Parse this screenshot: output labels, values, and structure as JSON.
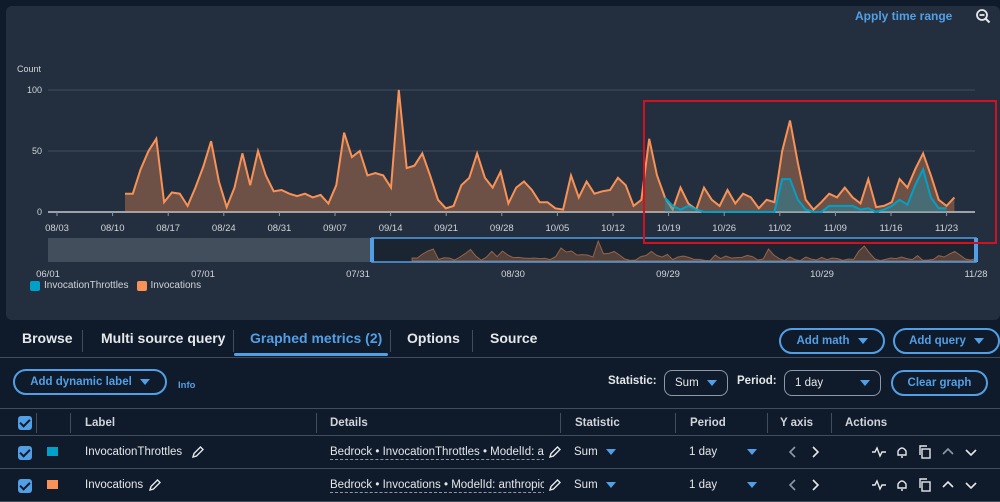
{
  "graph": {
    "apply_time_range": "Apply time range",
    "y_unit": "Count",
    "y_ticks": [
      "100",
      "50",
      "0"
    ],
    "x_ticks": [
      "08/03",
      "08/10",
      "08/17",
      "08/24",
      "08/31",
      "09/07",
      "09/14",
      "09/21",
      "09/28",
      "10/05",
      "10/12",
      "10/19",
      "10/26",
      "11/02",
      "11/09",
      "11/16",
      "11/23"
    ],
    "overview_ticks": [
      "06/01",
      "07/01",
      "07/31",
      "08/30",
      "09/29",
      "10/29",
      "11/28"
    ],
    "legend": [
      {
        "name": "InvocationThrottles",
        "color": "#00a1c9"
      },
      {
        "name": "Invocations",
        "color": "#f89256"
      }
    ],
    "highlight_color": "#d1111f"
  },
  "chart_data": {
    "type": "area",
    "ylabel": "Count",
    "ylim": [
      0,
      100
    ],
    "x": [
      "08/10",
      "08/11",
      "08/12",
      "08/13",
      "08/14",
      "08/15",
      "08/16",
      "08/17",
      "08/18",
      "08/19",
      "08/20",
      "08/21",
      "08/22",
      "08/23",
      "08/24",
      "08/25",
      "08/26",
      "08/27",
      "08/28",
      "08/29",
      "08/30",
      "08/31",
      "09/01",
      "09/02",
      "09/03",
      "09/04",
      "09/05",
      "09/06",
      "09/07",
      "09/08",
      "09/09",
      "09/10",
      "09/11",
      "09/12",
      "09/13",
      "09/14",
      "09/15",
      "09/16",
      "09/17",
      "09/18",
      "09/19",
      "09/20",
      "09/21",
      "09/22",
      "09/23",
      "09/24",
      "09/25",
      "09/26",
      "09/27",
      "09/28",
      "09/29",
      "09/30",
      "10/01",
      "10/02",
      "10/03",
      "10/04",
      "10/05",
      "10/06",
      "10/07",
      "10/08",
      "10/09",
      "10/10",
      "10/11",
      "10/12",
      "10/13",
      "10/14",
      "10/15",
      "10/16",
      "10/17",
      "10/18",
      "10/19",
      "10/20",
      "10/21",
      "10/22",
      "10/23",
      "10/24",
      "10/25",
      "10/26",
      "10/27",
      "10/28",
      "10/29",
      "10/30",
      "10/31",
      "11/01",
      "11/02",
      "11/03",
      "11/04",
      "11/05",
      "11/06",
      "11/07",
      "11/08",
      "11/09",
      "11/10",
      "11/11",
      "11/12",
      "11/13",
      "11/14",
      "11/15",
      "11/16",
      "11/17",
      "11/18",
      "11/19",
      "11/20",
      "11/21",
      "11/22",
      "11/23",
      "11/24",
      "11/25",
      "11/26"
    ],
    "series": [
      {
        "name": "Invocations",
        "color": "#f89256",
        "values": [
          15,
          15,
          35,
          50,
          60,
          8,
          16,
          15,
          5,
          20,
          37,
          58,
          25,
          4,
          20,
          48,
          22,
          50,
          30,
          17,
          18,
          15,
          13,
          15,
          12,
          14,
          7,
          22,
          65,
          45,
          50,
          30,
          32,
          30,
          20,
          100,
          36,
          38,
          48,
          30,
          10,
          3,
          5,
          22,
          28,
          48,
          28,
          20,
          33,
          7,
          20,
          25,
          18,
          8,
          8,
          3,
          2,
          30,
          12,
          25,
          15,
          17,
          18,
          28,
          22,
          5,
          10,
          60,
          30,
          12,
          2,
          20,
          7,
          2,
          20,
          10,
          5,
          18,
          7,
          15,
          12,
          3,
          10,
          8,
          50,
          75,
          40,
          10,
          2,
          8,
          15,
          12,
          20,
          12,
          7,
          27,
          4,
          5,
          8,
          27,
          20,
          35,
          48,
          30,
          10,
          5,
          12
        ]
      },
      {
        "name": "InvocationThrottles",
        "color": "#00a1c9",
        "values": [
          null,
          null,
          null,
          null,
          null,
          null,
          null,
          null,
          null,
          null,
          null,
          null,
          null,
          null,
          null,
          null,
          null,
          null,
          null,
          null,
          null,
          null,
          null,
          null,
          null,
          null,
          null,
          null,
          null,
          null,
          null,
          null,
          null,
          null,
          null,
          null,
          null,
          null,
          null,
          null,
          null,
          null,
          null,
          null,
          null,
          null,
          null,
          null,
          null,
          null,
          null,
          null,
          null,
          null,
          null,
          null,
          null,
          null,
          null,
          null,
          null,
          null,
          null,
          null,
          null,
          null,
          null,
          null,
          null,
          12,
          5,
          2,
          5,
          2,
          0,
          0,
          0,
          0,
          0,
          0,
          0,
          0,
          0,
          0,
          27,
          27,
          10,
          2,
          0,
          0,
          5,
          5,
          5,
          5,
          2,
          3,
          0,
          2,
          5,
          10,
          6,
          22,
          35,
          12,
          3,
          3,
          null
        ]
      }
    ]
  },
  "tabs": [
    {
      "label": "Browse"
    },
    {
      "label": "Multi source query"
    },
    {
      "label": "Graphed metrics (2)",
      "active": true
    },
    {
      "label": "Options"
    },
    {
      "label": "Source"
    }
  ],
  "toolbar": {
    "add_math": "Add math",
    "add_query": "Add query",
    "add_dynamic_label": "Add dynamic label",
    "info": "Info",
    "statistic_label": "Statistic:",
    "statistic_value": "Sum",
    "period_label": "Period:",
    "period_value": "1 day",
    "clear_graph": "Clear graph"
  },
  "table": {
    "headers": [
      "Label",
      "Details",
      "Statistic",
      "Period",
      "Y axis",
      "Actions"
    ],
    "rows": [
      {
        "label": "InvocationThrottles",
        "details": "Bedrock • InvocationThrottles • ModelId: anthropic",
        "statistic": "Sum",
        "period": "1 day",
        "color": "#00a1c9"
      },
      {
        "label": "Invocations",
        "details": "Bedrock • Invocations • ModelId: anthropic",
        "statistic": "Sum",
        "period": "1 day",
        "color": "#f89256"
      }
    ]
  }
}
